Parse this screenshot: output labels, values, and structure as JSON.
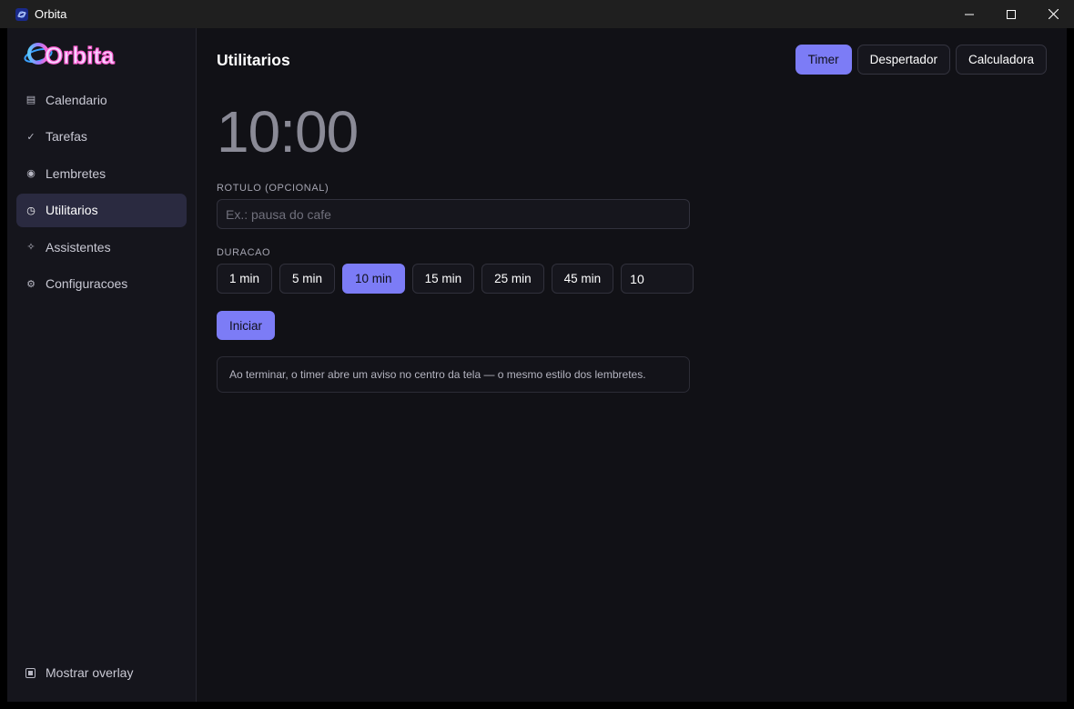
{
  "window": {
    "title": "Orbita"
  },
  "sidebar": {
    "logo_text": "Orbita",
    "items": [
      {
        "label": "Calendario",
        "icon": "calendar-icon",
        "active": false
      },
      {
        "label": "Tarefas",
        "icon": "check-icon",
        "active": false
      },
      {
        "label": "Lembretes",
        "icon": "bell-dot-icon",
        "active": false
      },
      {
        "label": "Utilitarios",
        "icon": "clock-icon",
        "active": true
      },
      {
        "label": "Assistentes",
        "icon": "sparkle-icon",
        "active": false
      },
      {
        "label": "Configuracoes",
        "icon": "gear-icon",
        "active": false
      }
    ],
    "overlay_toggle_label": "Mostrar overlay"
  },
  "header": {
    "title": "Utilitarios",
    "tabs": [
      {
        "label": "Timer",
        "active": true
      },
      {
        "label": "Despertador",
        "active": false
      },
      {
        "label": "Calculadora",
        "active": false
      }
    ]
  },
  "timer": {
    "display": "10:00",
    "label_field": {
      "label": "ROTULO (OPCIONAL)",
      "placeholder": "Ex.: pausa do cafe",
      "value": ""
    },
    "duration": {
      "label": "DURACAO",
      "presets": [
        {
          "label": "1 min",
          "active": false
        },
        {
          "label": "5 min",
          "active": false
        },
        {
          "label": "10 min",
          "active": true
        },
        {
          "label": "15 min",
          "active": false
        },
        {
          "label": "25 min",
          "active": false
        },
        {
          "label": "45 min",
          "active": false
        }
      ],
      "custom_value": "10"
    },
    "start_label": "Iniciar",
    "info_text": "Ao terminar, o timer abre um aviso no centro da tela — o mesmo estilo dos lembretes."
  },
  "colors": {
    "accent": "#7c7cf6",
    "background": "#111116",
    "sidebar": "#15151c",
    "active_nav": "#2a2a40"
  }
}
